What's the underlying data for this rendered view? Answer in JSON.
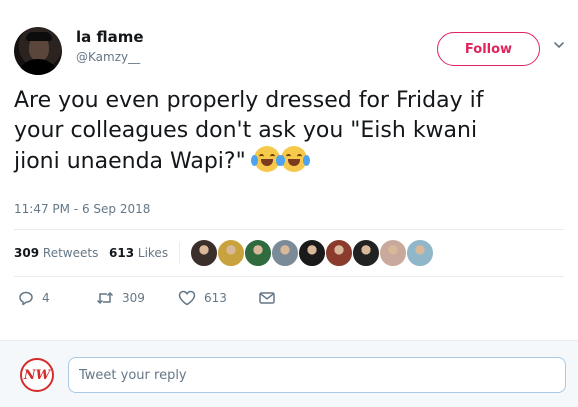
{
  "user": {
    "display_name": "la flame",
    "handle": "@Kamzy__",
    "follow_label": "Follow"
  },
  "tweet": {
    "text_line1": "Are you even properly dressed for Friday if",
    "text_line2": "your colleagues don't ask you \"Eish kwani",
    "text_line3": "jioni unaenda Wapi?\"",
    "emojis": [
      "face-with-tears-of-joy",
      "face-with-tears-of-joy"
    ],
    "timestamp": "11:47 PM - 6 Sep 2018"
  },
  "stats": {
    "retweets_count": "309",
    "retweets_label": "Retweets",
    "likes_count": "613",
    "likes_label": "Likes",
    "liker_avatar_colors": [
      "#3a2f2a",
      "#c8a23c",
      "#2f6b3f",
      "#7a8a96",
      "#1a1a1a",
      "#8a3b2e",
      "#222222",
      "#c9a99b",
      "#8fb6c9"
    ]
  },
  "actions": {
    "reply_count": "4",
    "retweet_count": "309",
    "like_count": "613"
  },
  "reply": {
    "logo_text": "NW",
    "placeholder": "Tweet your reply"
  },
  "colors": {
    "accent": "#e0245e",
    "muted": "#657786",
    "text": "#14171a"
  }
}
